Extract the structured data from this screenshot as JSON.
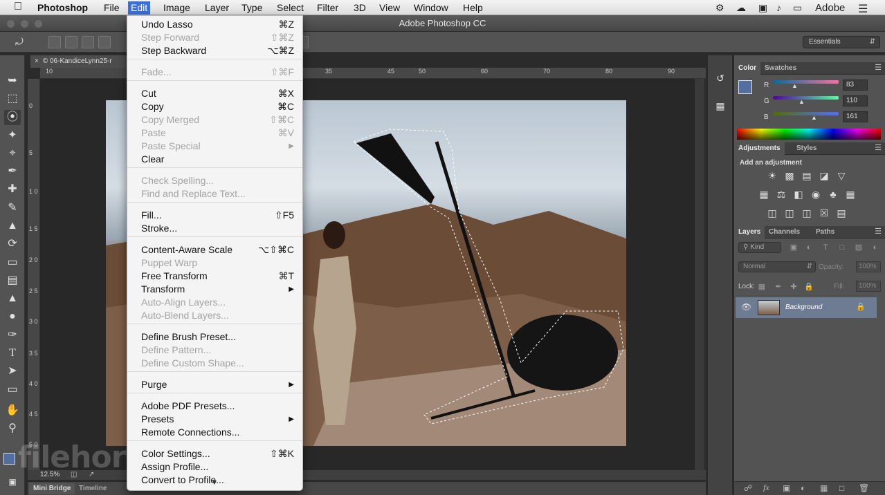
{
  "menubar": {
    "apple": "",
    "app": "Photoshop",
    "items": [
      "File",
      "Edit",
      "Image",
      "Layer",
      "Type",
      "Select",
      "Filter",
      "3D",
      "View",
      "Window",
      "Help"
    ],
    "active": "Edit",
    "tray_adobe": "Adobe"
  },
  "window": {
    "title": "Adobe Photoshop CC"
  },
  "options": {
    "workspace": "Essentials"
  },
  "document": {
    "tab": "© 06-KandiceLynn25-r",
    "zoom": "12.5%",
    "ruler_h": [
      "10",
      "35",
      "45",
      "50",
      "60",
      "70",
      "80",
      "90"
    ],
    "ruler_v": [
      "0",
      "5",
      "1 0",
      "1 5",
      "2 0",
      "2 5",
      "3 0",
      "3 5",
      "4 0",
      "4 5",
      "5 0"
    ]
  },
  "bottom_tabs": [
    "Mini Bridge",
    "Timeline"
  ],
  "edit_menu": {
    "items": [
      {
        "label": "Undo Lasso",
        "shortcut": "⌘Z",
        "enabled": true
      },
      {
        "label": "Step Forward",
        "shortcut": "⇧⌘Z",
        "enabled": false
      },
      {
        "label": "Step Backward",
        "shortcut": "⌥⌘Z",
        "enabled": true
      },
      {
        "label": "Fade...",
        "shortcut": "⇧⌘F",
        "enabled": false
      },
      {
        "label": "Cut",
        "shortcut": "⌘X",
        "enabled": true
      },
      {
        "label": "Copy",
        "shortcut": "⌘C",
        "enabled": true
      },
      {
        "label": "Copy Merged",
        "shortcut": "⇧⌘C",
        "enabled": false
      },
      {
        "label": "Paste",
        "shortcut": "⌘V",
        "enabled": false
      },
      {
        "label": "Paste Special",
        "shortcut": "▶",
        "enabled": false
      },
      {
        "label": "Clear",
        "shortcut": "",
        "enabled": true
      },
      {
        "label": "Check Spelling...",
        "shortcut": "",
        "enabled": false
      },
      {
        "label": "Find and Replace Text...",
        "shortcut": "",
        "enabled": false
      },
      {
        "label": "Fill...",
        "shortcut": "⇧F5",
        "enabled": true
      },
      {
        "label": "Stroke...",
        "shortcut": "",
        "enabled": true
      },
      {
        "label": "Content-Aware Scale",
        "shortcut": "⌥⇧⌘C",
        "enabled": true
      },
      {
        "label": "Puppet Warp",
        "shortcut": "",
        "enabled": false
      },
      {
        "label": "Free Transform",
        "shortcut": "⌘T",
        "enabled": true
      },
      {
        "label": "Transform",
        "shortcut": "▶",
        "enabled": true
      },
      {
        "label": "Auto-Align Layers...",
        "shortcut": "",
        "enabled": false
      },
      {
        "label": "Auto-Blend Layers...",
        "shortcut": "",
        "enabled": false
      },
      {
        "label": "Define Brush Preset...",
        "shortcut": "",
        "enabled": true
      },
      {
        "label": "Define Pattern...",
        "shortcut": "",
        "enabled": false
      },
      {
        "label": "Define Custom Shape...",
        "shortcut": "",
        "enabled": false
      },
      {
        "label": "Purge",
        "shortcut": "▶",
        "enabled": true
      },
      {
        "label": "Adobe PDF Presets...",
        "shortcut": "",
        "enabled": true
      },
      {
        "label": "Presets",
        "shortcut": "▶",
        "enabled": true
      },
      {
        "label": "Remote Connections...",
        "shortcut": "",
        "enabled": true
      },
      {
        "label": "Color Settings...",
        "shortcut": "⇧⌘K",
        "enabled": true
      },
      {
        "label": "Assign Profile...",
        "shortcut": "",
        "enabled": true
      },
      {
        "label": "Convert to Profile...",
        "shortcut": "",
        "enabled": true
      }
    ],
    "more_arrow": "▼"
  },
  "color_panel": {
    "tabs": [
      "Color",
      "Swatches"
    ],
    "r_label": "R",
    "g_label": "G",
    "b_label": "B",
    "r": "83",
    "g": "110",
    "b": "161",
    "fg_color": "#536EA1"
  },
  "adjustments_panel": {
    "tabs": [
      "Adjustments",
      "Styles"
    ],
    "heading": "Add an adjustment"
  },
  "layers_panel": {
    "tabs": [
      "Layers",
      "Channels",
      "Paths"
    ],
    "kind": "Kind",
    "blend": "Normal",
    "opacity_label": "Opacity:",
    "opacity": "100%",
    "lock_label": "Lock:",
    "fill_label": "Fill:",
    "fill": "100%",
    "layer_name": "Background"
  },
  "watermark": "filehorse.com"
}
